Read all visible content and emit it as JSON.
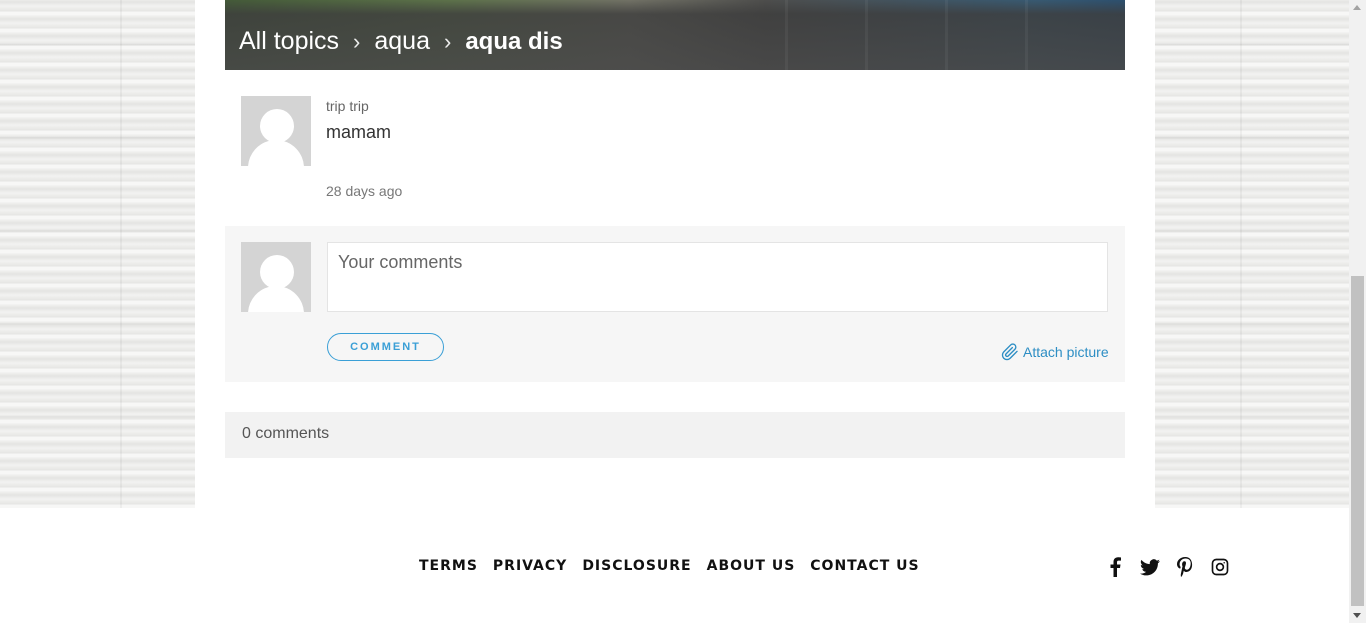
{
  "breadcrumb": {
    "items": [
      "All topics",
      "aqua"
    ],
    "current": "aqua dis",
    "separator": "›"
  },
  "post": {
    "author": "trip trip",
    "text": "mamam",
    "time": "28 days ago"
  },
  "comment_form": {
    "placeholder": "Your comments",
    "button_label": "COMMENT",
    "attach_label": "Attach picture"
  },
  "comments_count": "0 comments",
  "footer": {
    "links": [
      "TERMS",
      "PRIVACY",
      "DISCLOSURE",
      "ABOUT US",
      "CONTACT US"
    ],
    "social": [
      "facebook-icon",
      "twitter-icon",
      "pinterest-icon",
      "instagram-icon"
    ]
  },
  "colors": {
    "accent": "#3a9fd6",
    "link": "#2d8ec4"
  }
}
